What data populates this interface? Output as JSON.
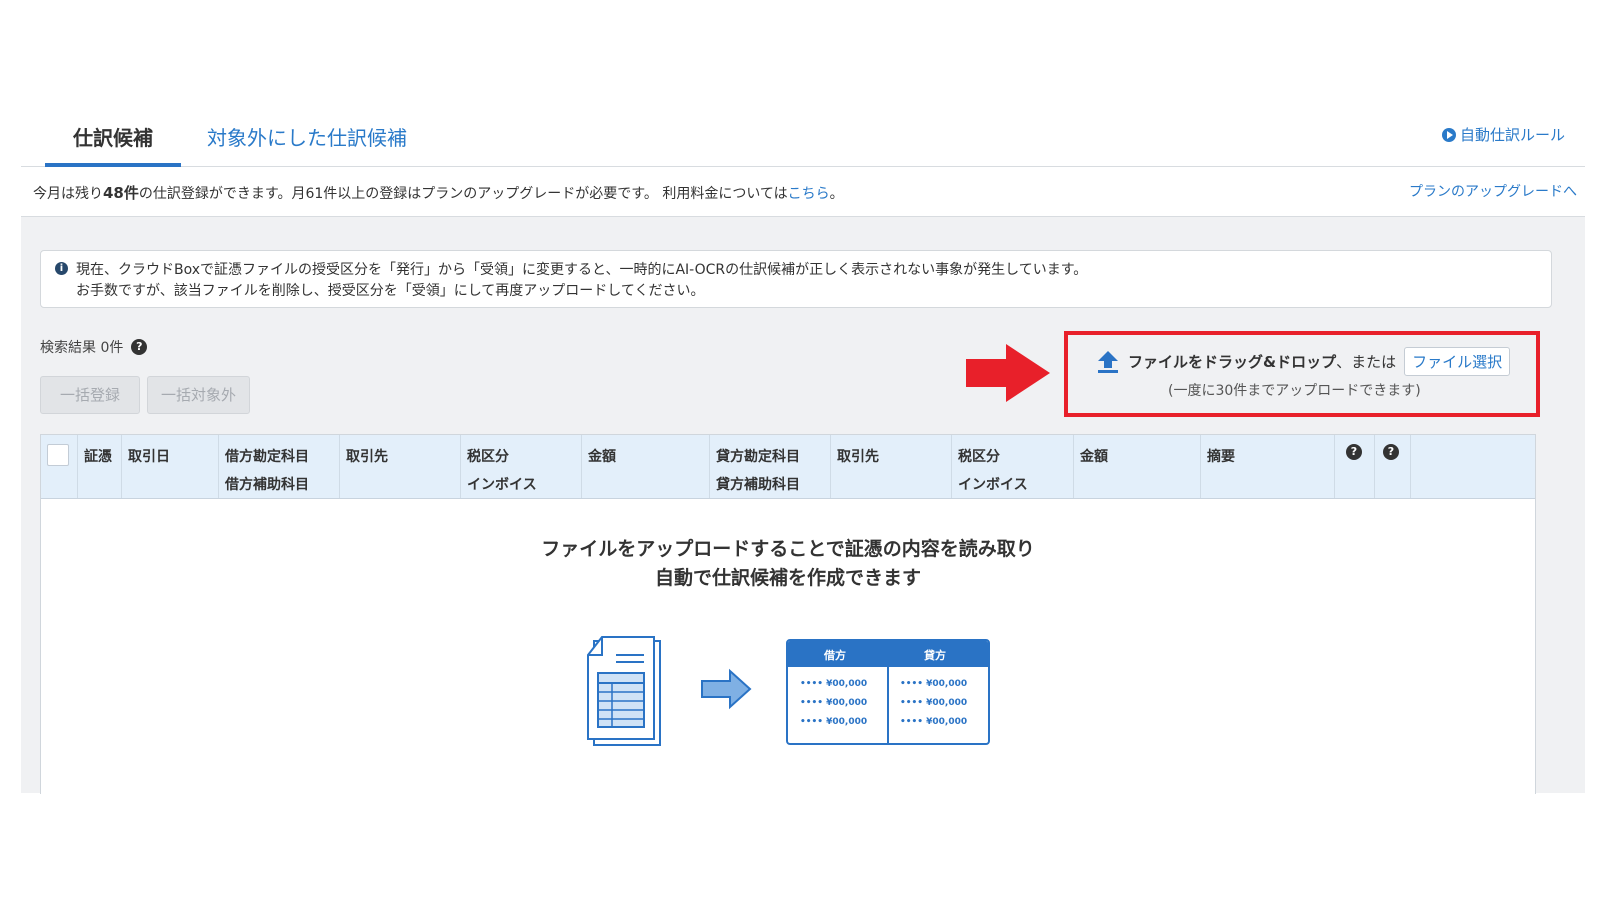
{
  "tabs": [
    {
      "label": "仕訳候補"
    },
    {
      "label": "対象外にした仕訳候補"
    }
  ],
  "auto_rule_link": "自動仕訳ルール",
  "quota": {
    "prefix": "今月は残り",
    "remaining": "48件",
    "middle": "の仕訳登録ができます。月61件以上の登録はプランのアップグレードが必要です。 利用料金については",
    "link": "こちら",
    "suffix": "。",
    "upgrade_link": "プランのアップグレードへ"
  },
  "notice": {
    "line1": "現在、クラウドBoxで証憑ファイルの授受区分を「発行」から「受領」に変更すると、一時的にAI-OCRの仕訳候補が正しく表示されない事象が発生しています。",
    "line2": "お手数ですが、該当ファイルを削除し、授受区分を「受領」にして再度アップロードしてください。"
  },
  "search_result": "検索結果 0件",
  "buttons": {
    "bulk_register": "一括登録",
    "bulk_exclude": "一括対象外"
  },
  "upload": {
    "drag_label": "ファイルをドラッグ&ドロップ",
    "or_label": "、または",
    "file_select": "ファイル選択",
    "limit_note": "(一度に30件までアップロードできます)"
  },
  "table": {
    "headers": {
      "evidence": "証憑",
      "date": "取引日",
      "debit_account": "借方勘定科目",
      "debit_sub": "借方補助科目",
      "debit_partner": "取引先",
      "debit_tax": "税区分",
      "debit_invoice": "インボイス",
      "debit_amount": "金額",
      "credit_account": "貸方勘定科目",
      "credit_sub": "貸方補助科目",
      "credit_partner": "取引先",
      "credit_tax": "税区分",
      "credit_invoice": "インボイス",
      "credit_amount": "金額",
      "memo": "摘要"
    }
  },
  "empty": {
    "line1": "ファイルをアップロードすることで証憑の内容を読み取り",
    "line2": "自動で仕訳候補を作成できます"
  },
  "ledger": {
    "debit": "借方",
    "credit": "貸方",
    "rows": [
      "•••• ¥00,000",
      "•••• ¥00,000",
      "•••• ¥00,000"
    ]
  }
}
